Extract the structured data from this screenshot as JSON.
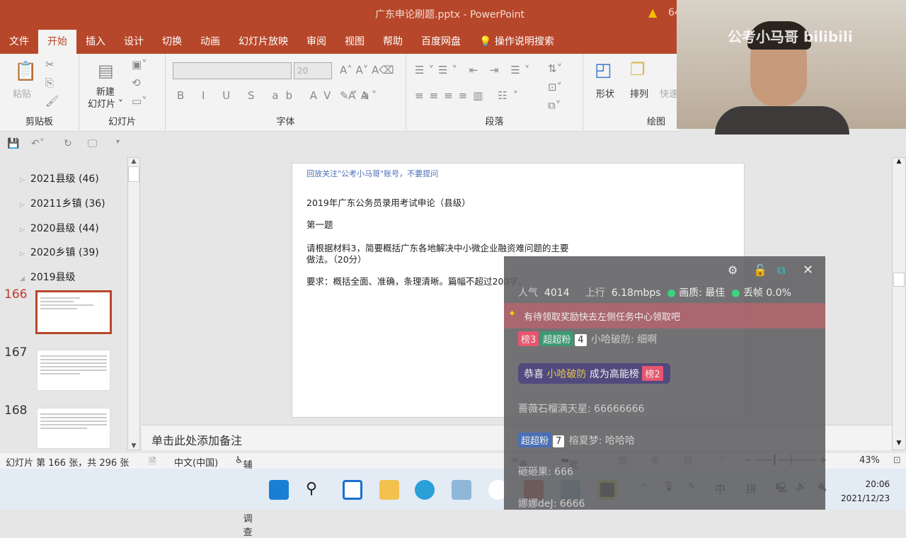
{
  "window": {
    "title": "广东申论刷题.pptx  -  PowerPoint",
    "warning_text": "64"
  },
  "tabs": [
    "文件",
    "开始",
    "插入",
    "设计",
    "切换",
    "动画",
    "幻灯片放映",
    "审阅",
    "视图",
    "帮助",
    "百度网盘"
  ],
  "tell_me": "操作说明搜索",
  "ribbon": {
    "clipboard": {
      "label": "剪贴板",
      "paste": "粘贴"
    },
    "slides": {
      "label": "幻灯片",
      "new_slide": "新建",
      "new_slide2": "幻灯片"
    },
    "font": {
      "label": "字体",
      "font_name": "",
      "font_size": "20"
    },
    "paragraph": {
      "label": "段落"
    },
    "drawing": {
      "label": "绘图",
      "shapes": "形状",
      "arrange": "排列",
      "quick": "快速"
    }
  },
  "sections": [
    {
      "label": "2021县级 (46)",
      "expanded": false
    },
    {
      "label": "20211乡镇 (36)",
      "expanded": false
    },
    {
      "label": "2020县级 (44)",
      "expanded": false
    },
    {
      "label": "2020乡镇 (39)",
      "expanded": false
    },
    {
      "label": "2019县级",
      "expanded": true
    }
  ],
  "thumbnails": [
    {
      "num": "166",
      "selected": true
    },
    {
      "num": "167"
    },
    {
      "num": "168"
    }
  ],
  "slide": {
    "header": "回放关注\"公考小马哥\"账号，不要提问",
    "lines": [
      "2019年广东公务员录用考试申论（县级）",
      "第一题",
      "请根据材料3，简要概括广东各地解决中小微企业融资难问题的主要",
      "做法。（20分）",
      "要求：概括全面、准确，条理清晰。篇幅不超过200字。"
    ]
  },
  "notes_placeholder": "单击此处添加备注",
  "status": {
    "slide_info": "幻灯片 第 166 张，共 296 张",
    "language": "中文(中国)",
    "accessibility": "辅助功能: 调查",
    "notes": "备注",
    "comments": "批注",
    "zoom": "43%"
  },
  "taskbar": {
    "time": "20:06",
    "date": "2021/12/23",
    "ime1": "中",
    "ime2": "拼"
  },
  "stream": {
    "popularity_label": "人气",
    "popularity": "4014",
    "upload_label": "上行",
    "upload": "6.18mbps",
    "quality": "画质: 最佳",
    "drop": "丢帧 0.0%",
    "notice": "有待领取奖励快去左侧任务中心领取吧",
    "messages": [
      {
        "badge_rank": "榜3",
        "fan": "超超粉",
        "level": "4",
        "text": "小哈破防: 细啊"
      },
      {
        "prefix": "恭喜",
        "user": "小哈破防",
        "suffix": "成为高能榜",
        "badge": "榜2"
      },
      {
        "text": "蔷薇石榴满天星: 66666666"
      },
      {
        "fan": "超超粉",
        "level": "7",
        "text": "榕夏梦: 哈哈哈"
      },
      {
        "text": "砸砸果: 666"
      },
      {
        "text": "娜娜deJ: 6666"
      }
    ]
  },
  "webcam": {
    "watermark": "公考小马哥 bilibili"
  }
}
